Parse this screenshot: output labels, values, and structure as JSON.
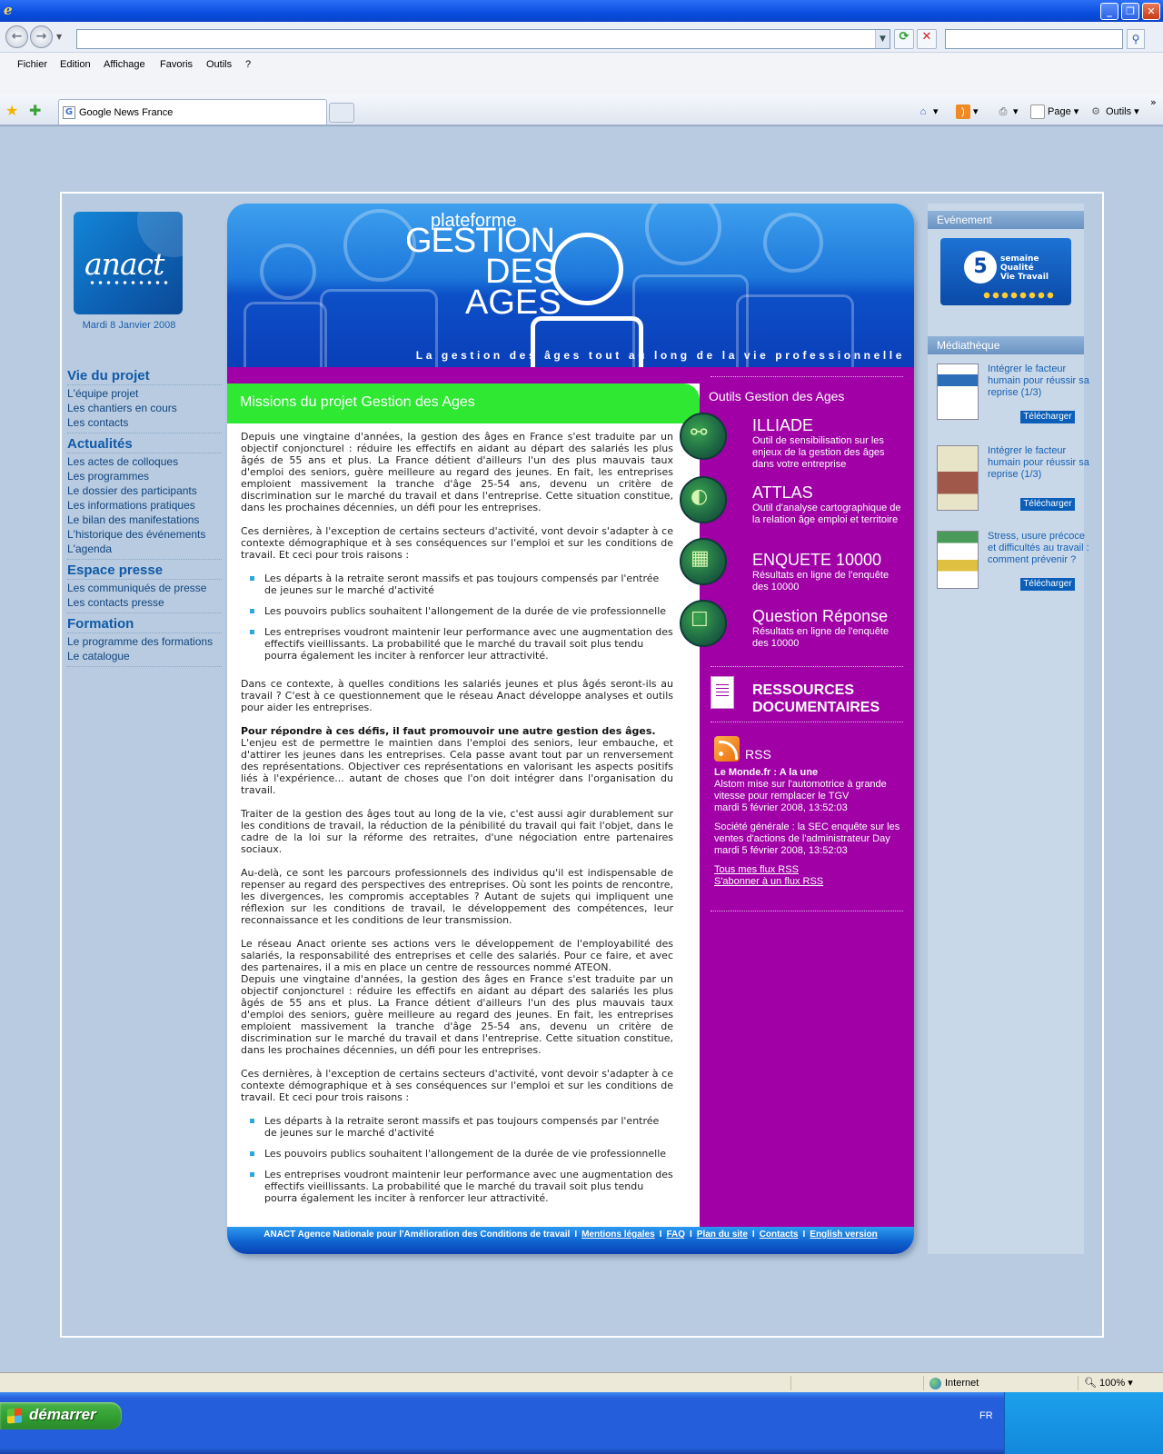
{
  "browser": {
    "menu": [
      "Fichier",
      "Edition",
      "Affichage",
      "Favoris",
      "Outils",
      "?"
    ],
    "tab_title": "Google News France",
    "commands": {
      "page": "Page",
      "tools": "Outils"
    },
    "status": {
      "zone": "Internet",
      "zoom": "100%"
    }
  },
  "taskbar": {
    "start_label": "démarrer",
    "language": "FR"
  },
  "site": {
    "logo_text": "anact",
    "date": "Mardi 8 Janvier 2008",
    "nav": [
      {
        "title": "Vie du projet",
        "links": [
          "L'équipe projet",
          "Les chantiers en cours",
          "Les contacts"
        ]
      },
      {
        "title": "Actualités",
        "links": [
          "Les actes de colloques",
          "Les programmes",
          "Le dossier des participants",
          "Les informations pratiques",
          "Le bilan des manifestations",
          "L'historique des événements",
          "L'agenda"
        ]
      },
      {
        "title": "Espace presse",
        "links": [
          "Les communiqués de presse",
          "Les contacts presse"
        ]
      },
      {
        "title": "Formation",
        "links": [
          "Le programme des formations",
          "Le catalogue"
        ]
      }
    ],
    "banner": {
      "plateforme": "plateforme",
      "line1": "GESTION",
      "line2": "DES",
      "line3": "AGES",
      "tagline": "La gestion des âges tout au long de la vie professionnelle"
    },
    "missions_title": "Missions du projet Gestion des Ages",
    "article": {
      "p1": "Depuis une vingtaine d'années, la gestion des âges en France s'est traduite par un objectif conjoncturel : réduire les effectifs en aidant au départ des salariés les plus âgés de 55 ans et plus. La France détient d'ailleurs l'un des plus mauvais taux d'emploi des seniors, guère meilleure au regard des jeunes. En fait, les entreprises emploient massivement la tranche d'âge 25-54 ans, devenu un critère de discrimination sur le marché du travail et dans l'entreprise. Cette situation constitue, dans les prochaines décennies, un défi pour les entreprises.",
      "p2": "Ces dernières, à l'exception de certains secteurs d'activité, vont devoir s'adapter à ce contexte démographique et à ses conséquences sur l'emploi et sur les conditions de travail. Et ceci pour trois raisons :",
      "bullets": [
        "Les départs à la retraite seront massifs et pas toujours compensés par l'entrée de jeunes sur le marché d'activité",
        "Les pouvoirs publics souhaitent l'allongement de la durée de vie professionnelle",
        "Les entreprises voudront maintenir leur performance avec une augmentation des effectifs vieillissants. La probabilité que le marché du travail soit plus tendu pourra également les inciter à renforcer leur attractivité."
      ],
      "p3": "Dans ce contexte, à quelles conditions les salariés jeunes et plus âgés seront-ils au travail ? C'est à ce questionnement que le réseau Anact développe analyses et outils pour aider les entreprises.",
      "p4_strong": "Pour répondre à ces défis, il faut promouvoir une autre gestion des âges.",
      "p4": "L'enjeu est de permettre le maintien dans l'emploi des seniors, leur embauche, et d'attirer les jeunes dans les entreprises. Cela passe avant tout par un renversement des représentations. Objectiver ces représentations en valorisant les aspects positifs liés à l'expérience... autant de choses que l'on doit intégrer dans l'organisation du travail.",
      "p5": "Traiter de la gestion des âges tout au long de la vie, c'est aussi agir durablement sur les conditions de travail, la réduction de la pénibilité du travail qui fait l'objet, dans le cadre de la loi sur la réforme des retraites, d'une négociation entre partenaires sociaux.",
      "p6": "Au-delà, ce sont les parcours professionnels des individus qu'il est indispensable de repenser au regard des perspectives des entreprises. Où sont les points de rencontre, les divergences, les compromis acceptables ? Autant de sujets qui impliquent une réflexion sur les conditions de travail, le développement des compétences, leur reconnaissance et les conditions de leur transmission.",
      "p7": "Le réseau Anact oriente ses actions vers le développement de l'employabilité des salariés, la responsabilité des entreprises et celle des salariés. Pour ce faire, et avec des partenaires, il a mis en place un centre de ressources nommé ATEON."
    },
    "tools": {
      "title": "Outils Gestion des Ages",
      "items": [
        {
          "name": "ILLIADE",
          "desc": "Outil de sensibilisation sur les enjeux de la gestion des âges dans votre entreprise"
        },
        {
          "name": "ATTLAS",
          "desc": "Outil d'analyse cartographique de la relation âge emploi et territoire"
        },
        {
          "name": "ENQUETE 10000",
          "desc": "Résultats en ligne de l'enquête des 10000"
        },
        {
          "name": "Question Réponse",
          "desc": "Résultats en ligne de l'enquête des 10000"
        }
      ],
      "resources_line1": "RESSOURCES",
      "resources_line2": "DOCUMENTAIRES"
    },
    "rss": {
      "label": "RSS",
      "source": "Le Monde.fr : A la une",
      "items": [
        {
          "text": "Alstom mise sur l'automotrice à grande vitesse pour remplacer le TGV",
          "date": "mardi 5 février 2008, 13:52:03"
        },
        {
          "text": "Société générale : la SEC enquête sur les ventes d'actions de l'administrateur Day",
          "date": "mardi 5 février 2008, 13:52:03"
        }
      ],
      "link_all": "Tous mes flux RSS",
      "link_subscribe": "S'abonner à un flux RSS"
    },
    "footer": {
      "org": "ANACT Agence Nationale pour l'Amélioration des Conditions de travail",
      "links": [
        "Mentions légales",
        "FAQ",
        "Plan du site",
        "Contacts",
        "English version"
      ]
    },
    "right": {
      "event_title": "Evénement",
      "event_number": "5",
      "event_text_line1": "semaine",
      "event_text_line2": "Qualité",
      "event_text_line3": "Vie Travail",
      "media_title": "Médiathèque",
      "media": [
        {
          "title": "Intégrer le facteur humain pour réussir sa reprise (1/3)",
          "button": "Télécharger"
        },
        {
          "title": "Intégrer le facteur humain pour réussir sa reprise (1/3)",
          "button": "Télécharger"
        },
        {
          "title": "Stress, usure précoce et difficultés au travail : comment prévenir ?",
          "button": "Télécharger"
        }
      ]
    }
  }
}
